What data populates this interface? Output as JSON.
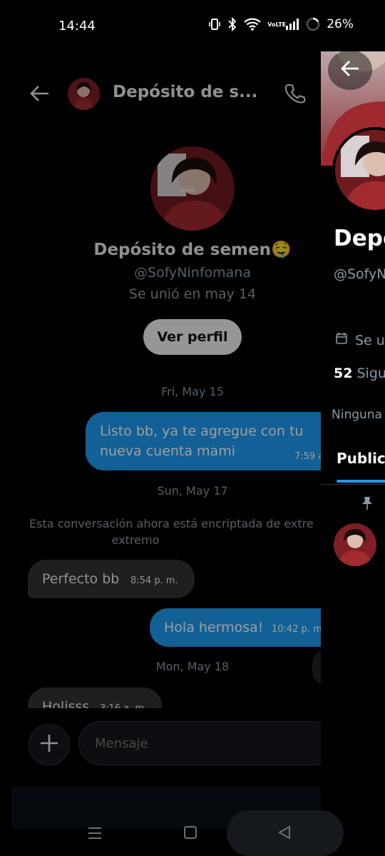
{
  "status_bar": {
    "time": "14:44",
    "battery": "26%",
    "network": "VoLTE"
  },
  "chat": {
    "header_title": "Depósito de s...",
    "profile_name": "Depósito de semen🤤",
    "handle": "@SofyNinfomana",
    "joined": "Se unió en may 14",
    "view_profile_label": "Ver perfil",
    "messages": [
      {
        "type": "date",
        "text": "Fri, May 15"
      },
      {
        "type": "out",
        "text_line1": "Listo bb, ya te agregue con tu",
        "text_line2": "nueva cuenta mami",
        "time": "7:59 a"
      },
      {
        "type": "date",
        "text": "Sun, May 17"
      },
      {
        "type": "system",
        "text_line1": "Esta conversación ahora está encriptada de extre",
        "text_line2": "extremo"
      },
      {
        "type": "in",
        "text": "Perfecto bb",
        "time": "8:54 p. m."
      },
      {
        "type": "out",
        "text": "Hola hermosa!",
        "time": "10:42 p. m"
      },
      {
        "type": "date",
        "text": "Mon, May 18"
      },
      {
        "type": "in",
        "text": "Holisss",
        "time": "3:16 a. m."
      }
    ],
    "composer_placeholder": "Mensaje"
  },
  "profile": {
    "name": "Depo",
    "handle": "@SofyN",
    "joined": "Se u",
    "following_count": "52",
    "following_label": "Sigu",
    "none_text": "Ninguna",
    "tab_label": "Public"
  },
  "colors": {
    "accent": "#1d9bf0",
    "background": "#000000",
    "incoming": "#2f3336"
  }
}
